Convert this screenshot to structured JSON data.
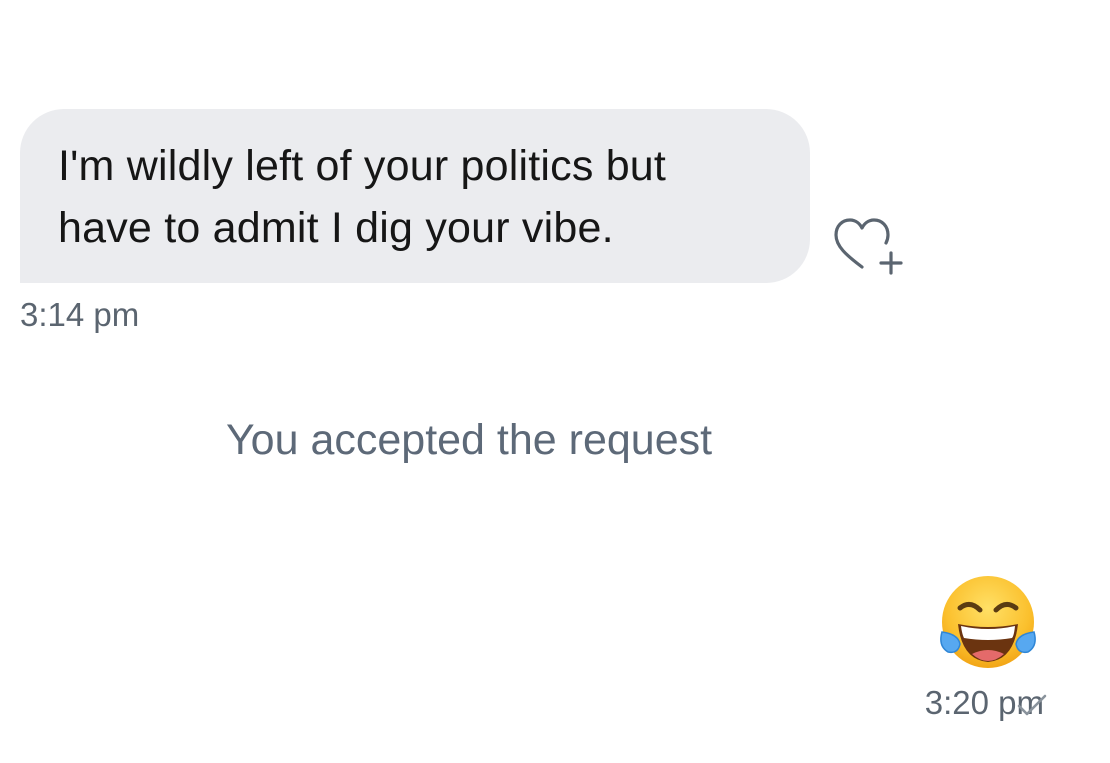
{
  "conversation": {
    "incoming_message": {
      "text": "I'm wildly left of your politics but have to admit I dig your vibe.",
      "line1": "I'm wildly left of your politics but",
      "line2": "have to admit I dig your vibe.",
      "time": "3:14 pm",
      "reaction_icon": "heart-plus-icon"
    },
    "system_notice": "You accepted the request",
    "outgoing_message": {
      "emoji": "face-with-tears-of-joy",
      "time": "3:20 pm",
      "status_icon": "checkmark-icon"
    }
  },
  "colors": {
    "incoming_bubble": "#ebecef",
    "message_text": "#161616",
    "secondary_text": "#5b6570",
    "background": "#ffffff"
  }
}
